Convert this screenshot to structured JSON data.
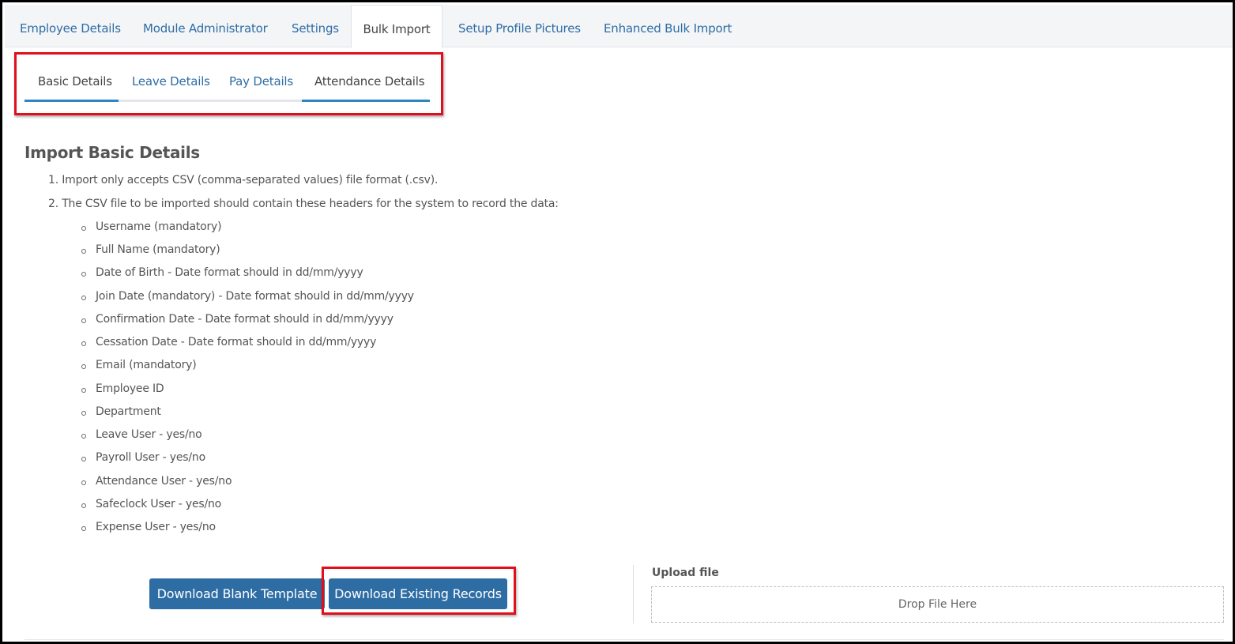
{
  "top_tabs": [
    {
      "label": "Employee Details",
      "active": false
    },
    {
      "label": "Module Administrator",
      "active": false
    },
    {
      "label": "Settings",
      "active": false
    },
    {
      "label": "Bulk Import",
      "active": true
    },
    {
      "label": "Setup Profile Pictures",
      "active": false
    },
    {
      "label": "Enhanced Bulk Import",
      "active": false
    }
  ],
  "sub_tabs": [
    {
      "label": "Basic Details",
      "active": true
    },
    {
      "label": "Leave Details",
      "active": false
    },
    {
      "label": "Pay Details",
      "active": false
    },
    {
      "label": "Attendance Details",
      "active": false
    }
  ],
  "section_title": "Import Basic Details",
  "instructions": [
    "1. Import only accepts CSV (comma-separated values) file format (.csv).",
    "2. The CSV file to be imported should contain these headers for the system to record the data:"
  ],
  "headers": [
    "Username (mandatory)",
    "Full Name (mandatory)",
    "Date of Birth - Date format should in dd/mm/yyyy",
    "Join Date (mandatory) - Date format should in dd/mm/yyyy",
    "Confirmation Date - Date format should in dd/mm/yyyy",
    "Cessation Date - Date format should in dd/mm/yyyy",
    "Email (mandatory)",
    "Employee ID",
    "Department",
    "Leave User - yes/no",
    "Payroll User - yes/no",
    "Attendance User - yes/no",
    "Safeclock User - yes/no",
    "Expense User - yes/no"
  ],
  "buttons": {
    "download_blank": "Download Blank Template",
    "download_existing": "Download Existing Records"
  },
  "upload": {
    "label": "Upload file",
    "drop_text": "Drop File Here"
  },
  "colors": {
    "accent": "#2e6da4",
    "highlight": "#e10e1c"
  }
}
